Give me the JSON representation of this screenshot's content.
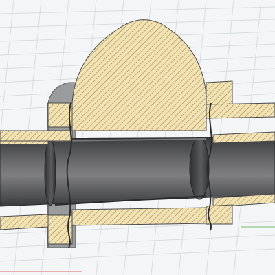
{
  "viewport": {
    "background": "#f4f5f6",
    "grid_color": "#cfd5db",
    "axis_red": "#e06a6a",
    "axis_green": "#6fbf6f"
  },
  "model": {
    "hatch_fill": "#f2e2b2",
    "hatch_line": "#8f7f55",
    "section_outline": "#4a4a4a",
    "shaft_dark": "#2f3032",
    "shaft_mid": "#606062",
    "shaft_light": "#7f7f80",
    "housing_gray": "#9a9b9c"
  }
}
